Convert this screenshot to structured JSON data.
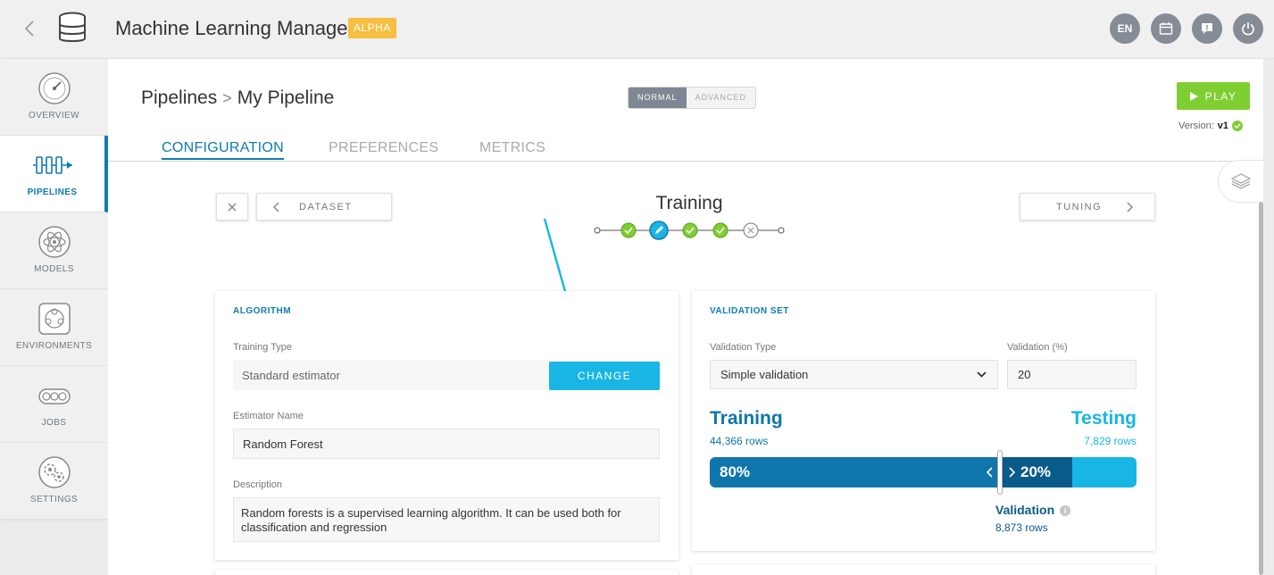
{
  "header": {
    "app_title": "Machine Learning Manager",
    "badge": "ALPHA",
    "lang": "EN"
  },
  "sidebar": {
    "items": [
      {
        "label": "OVERVIEW",
        "icon": "gauge-icon"
      },
      {
        "label": "PIPELINES",
        "icon": "pipeline-icon"
      },
      {
        "label": "MODELS",
        "icon": "atom-icon"
      },
      {
        "label": "ENVIRONMENTS",
        "icon": "environment-icon"
      },
      {
        "label": "JOBS",
        "icon": "conveyor-icon"
      },
      {
        "label": "SETTINGS",
        "icon": "gears-icon"
      }
    ],
    "active_index": 1
  },
  "breadcrumb": {
    "parent": "Pipelines",
    "sep": ">",
    "current": "My Pipeline"
  },
  "mode_toggle": {
    "normal": "NORMAL",
    "advanced": "ADVANCED",
    "selected": "NORMAL"
  },
  "play": {
    "label": "PLAY"
  },
  "version": {
    "label": "Version:",
    "value": "v1"
  },
  "tabs": {
    "configuration": "CONFIGURATION",
    "preferences": "PREFERENCES",
    "metrics": "METRICS",
    "active": "CONFIGURATION"
  },
  "steps": {
    "prev_label": "DATASET",
    "next_label": "TUNING",
    "current_title": "Training",
    "states": [
      "done",
      "current",
      "done",
      "done",
      "skipped"
    ]
  },
  "algorithm": {
    "title": "ALGORITHM",
    "training_type_label": "Training Type",
    "training_type_value": "Standard estimator",
    "change_label": "CHANGE",
    "estimator_name_label": "Estimator Name",
    "estimator_name_value": "Random Forest",
    "description_label": "Description",
    "description_value": "Random forests is a supervised learning algorithm. It can be used both for classification and regression"
  },
  "validation": {
    "title": "VALIDATION SET",
    "type_label": "Validation Type",
    "type_value": "Simple validation",
    "pct_label": "Validation (%)",
    "pct_value": "20",
    "training_label": "Training",
    "training_rows": "44,366 rows",
    "testing_label": "Testing",
    "testing_rows": "7,829 rows",
    "train_pct_text": "80%",
    "val_pct_text": "20%",
    "validation_label": "Validation",
    "validation_rows": "8,873 rows",
    "train_fraction": 0.68,
    "val_fraction": 0.17
  },
  "colors": {
    "primary": "#0f7bb3",
    "accent": "#19b5e5",
    "success": "#7fcf32",
    "badge": "#f6bf3f"
  }
}
